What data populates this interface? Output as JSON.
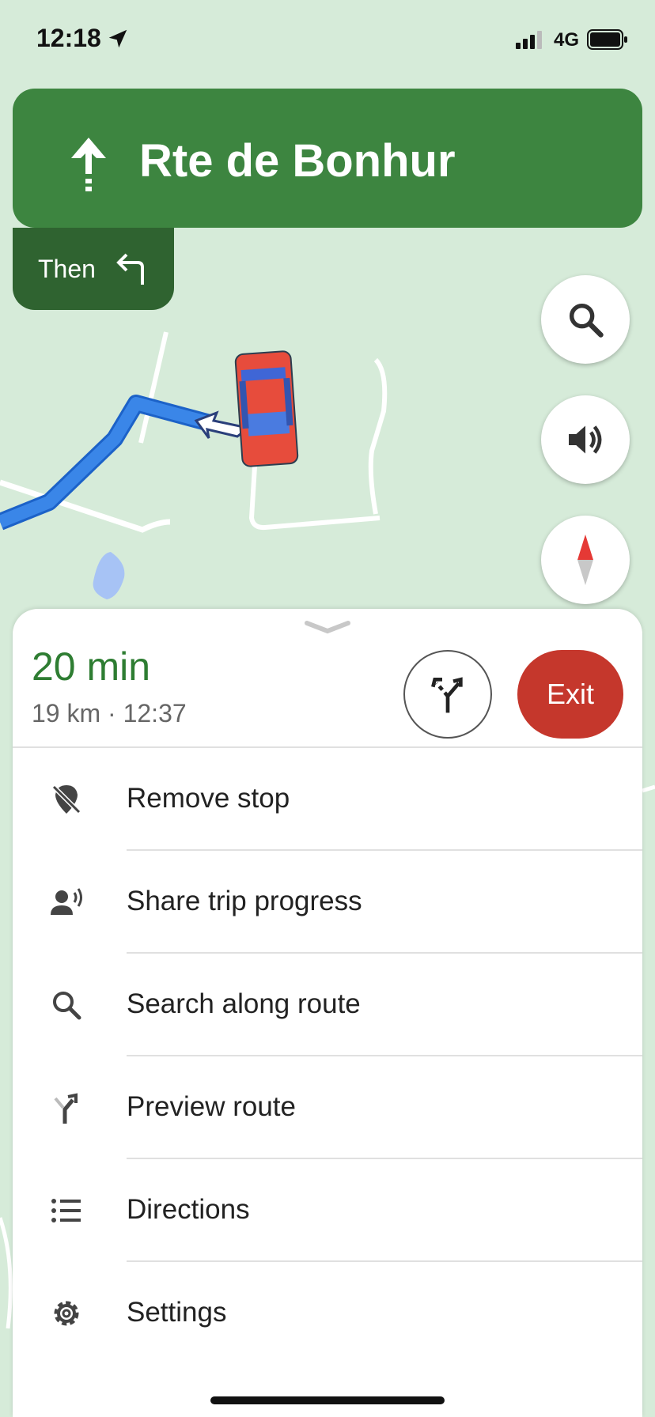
{
  "status_bar": {
    "time": "12:18",
    "network": "4G"
  },
  "navigation": {
    "direction_icon": "straight-arrow-icon",
    "street": "Rte de Bonhur",
    "then_label": "Then",
    "then_icon": "turn-left-icon"
  },
  "map_controls": {
    "search_icon": "search-icon",
    "sound_icon": "volume-icon",
    "compass_icon": "compass-icon"
  },
  "trip": {
    "eta": "20 min",
    "details": "19 km · 12:37",
    "alternate_icon": "alternate-routes-icon",
    "exit_label": "Exit"
  },
  "menu": {
    "items": [
      {
        "label": "Remove stop",
        "icon": "remove-stop-icon"
      },
      {
        "label": "Share trip progress",
        "icon": "share-trip-icon"
      },
      {
        "label": "Search along route",
        "icon": "search-icon"
      },
      {
        "label": "Preview route",
        "icon": "preview-route-icon"
      },
      {
        "label": "Directions",
        "icon": "list-icon"
      },
      {
        "label": "Settings",
        "icon": "gear-icon"
      }
    ]
  },
  "colors": {
    "nav_green": "#3d8540",
    "then_green": "#2f6330",
    "eta_green": "#2e7d32",
    "exit_red": "#c5372c",
    "route_blue": "#3a86e8",
    "map_bg": "#d6ebd9"
  }
}
